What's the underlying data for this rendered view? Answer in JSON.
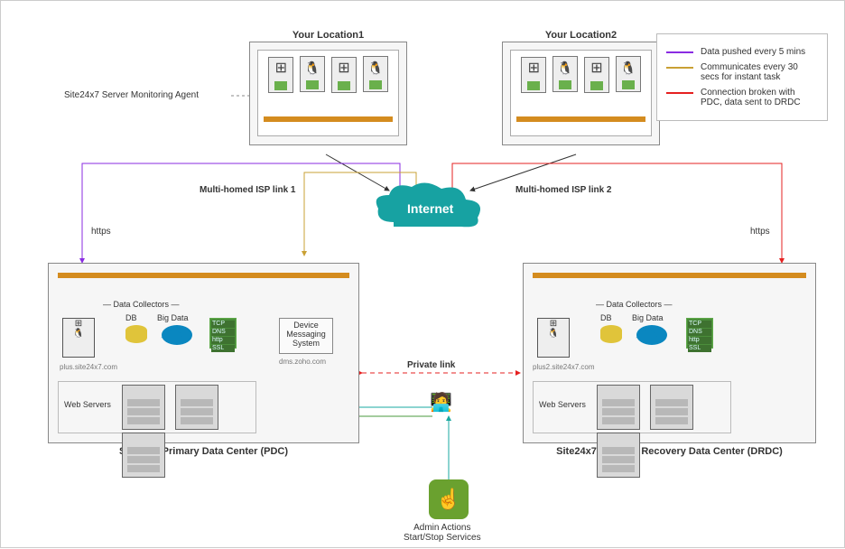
{
  "locations": {
    "loc1": {
      "title": "Your Location1"
    },
    "loc2": {
      "title": "Your Location2"
    }
  },
  "agent_label": "Site24x7 Server Monitoring Agent",
  "internet": "Internet",
  "isp1": "Multi-homed ISP link 1",
  "isp2": "Multi-homed ISP link 2",
  "https": "https",
  "pdc": {
    "title": "Site24x7 Primary Data Center (PDC)",
    "data_collectors": "Data Collectors",
    "db": "DB",
    "bigdata": "Big Data",
    "dms": "Device Messaging System",
    "web_servers": "Web Servers",
    "host": "plus.site24x7.com",
    "dms_host": "dms.zoho.com"
  },
  "drdc": {
    "title": "Site24x7 Disaster Recovery Data Center (DRDC)",
    "data_collectors": "Data Collectors",
    "db": "DB",
    "bigdata": "Big Data",
    "web_servers": "Web Servers",
    "host": "plus2.site24x7.com"
  },
  "private_link": "Private link",
  "admin": "Admin Actions\nStart/Stop Services",
  "mini_labels": {
    "tcp": "TCP",
    "dns": "DNS",
    "http": "http",
    "ssl": "SSL"
  },
  "legend": {
    "purple": {
      "color": "#8a2be2",
      "text": "Data pushed every 5 mins"
    },
    "yellow": {
      "color": "#c9a034",
      "text": "Communicates every 30 secs for instant task"
    },
    "red": {
      "color": "#e52020",
      "text": "Connection broken with PDC, data sent to DRDC"
    }
  }
}
